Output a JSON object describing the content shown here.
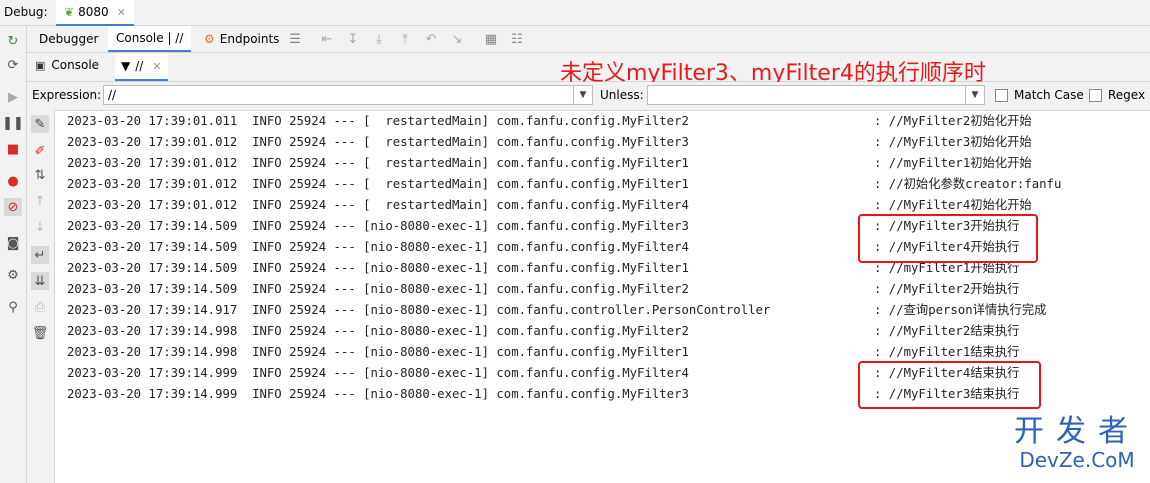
{
  "debug_bar": {
    "label": "Debug:",
    "tab_label": "8080"
  },
  "tabs": [
    "Debugger",
    "Console | //",
    "Endpoints"
  ],
  "subtabs": [
    "Console",
    "//"
  ],
  "filter": {
    "expression_label": "Expression:",
    "expression_value": "//",
    "unless_label": "Unless:",
    "unless_value": "",
    "match_case_label": "Match Case",
    "regex_label": "Regex"
  },
  "annotation": "未定义myFilter3、myFilter4的执行顺序时",
  "watermark": {
    "line1": "开发者",
    "line2": "DevZe.CoM"
  },
  "log_lines": [
    {
      "prefix": "2023-03-20 17:39:01.011  INFO 25924 --- [  restartedMain] com.fanfu.config.MyFilter2",
      "message": ": //MyFilter2初始化开始"
    },
    {
      "prefix": "2023-03-20 17:39:01.012  INFO 25924 --- [  restartedMain] com.fanfu.config.MyFilter3",
      "message": ": //MyFilter3初始化开始"
    },
    {
      "prefix": "2023-03-20 17:39:01.012  INFO 25924 --- [  restartedMain] com.fanfu.config.MyFilter1",
      "message": ": //myFilter1初始化开始"
    },
    {
      "prefix": "2023-03-20 17:39:01.012  INFO 25924 --- [  restartedMain] com.fanfu.config.MyFilter1",
      "message": ": //初始化参数creator:fanfu"
    },
    {
      "prefix": "2023-03-20 17:39:01.012  INFO 25924 --- [  restartedMain] com.fanfu.config.MyFilter4",
      "message": ": //MyFilter4初始化开始"
    },
    {
      "prefix": "2023-03-20 17:39:14.509  INFO 25924 --- [nio-8080-exec-1] com.fanfu.config.MyFilter3",
      "message": ": //MyFilter3开始执行"
    },
    {
      "prefix": "2023-03-20 17:39:14.509  INFO 25924 --- [nio-8080-exec-1] com.fanfu.config.MyFilter4",
      "message": ": //MyFilter4开始执行"
    },
    {
      "prefix": "2023-03-20 17:39:14.509  INFO 25924 --- [nio-8080-exec-1] com.fanfu.config.MyFilter1",
      "message": ": //myFilter1开始执行"
    },
    {
      "prefix": "2023-03-20 17:39:14.509  INFO 25924 --- [nio-8080-exec-1] com.fanfu.config.MyFilter2",
      "message": ": //MyFilter2开始执行"
    },
    {
      "prefix": "2023-03-20 17:39:14.917  INFO 25924 --- [nio-8080-exec-1] com.fanfu.controller.PersonController",
      "message": ": //查询person详情执行完成"
    },
    {
      "prefix": "2023-03-20 17:39:14.998  INFO 25924 --- [nio-8080-exec-1] com.fanfu.config.MyFilter2",
      "message": ": //MyFilter2结束执行"
    },
    {
      "prefix": "2023-03-20 17:39:14.998  INFO 25924 --- [nio-8080-exec-1] com.fanfu.config.MyFilter1",
      "message": ": //myFilter1结束执行"
    },
    {
      "prefix": "2023-03-20 17:39:14.999  INFO 25924 --- [nio-8080-exec-1] com.fanfu.config.MyFilter4",
      "message": ": //MyFilter4结束执行"
    },
    {
      "prefix": "2023-03-20 17:39:14.999  INFO 25924 --- [nio-8080-exec-1] com.fanfu.config.MyFilter3",
      "message": ": //MyFilter3结束执行"
    }
  ],
  "colors": {
    "highlight_box": "#e8161b",
    "annotation": "#ea1a1a",
    "watermark": "#2c63b8",
    "active_tab": "#4083c9"
  }
}
